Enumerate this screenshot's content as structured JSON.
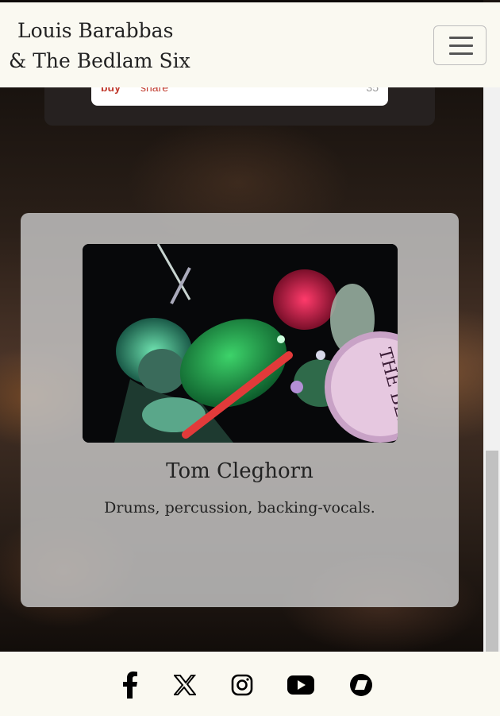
{
  "header": {
    "brand_line1": "Louis Barabbas",
    "brand_line2": "& The Bedlam Six"
  },
  "embed": {
    "buy_label": "buy",
    "share_label": "share",
    "count": "35"
  },
  "member": {
    "name": "Tom Cleghorn",
    "role": "Drums, percussion, backing-vocals.",
    "drum_text": "THE BEDLAM"
  },
  "footer": {
    "icons": [
      "facebook-icon",
      "x-icon",
      "instagram-icon",
      "youtube-icon",
      "bandcamp-icon"
    ]
  }
}
